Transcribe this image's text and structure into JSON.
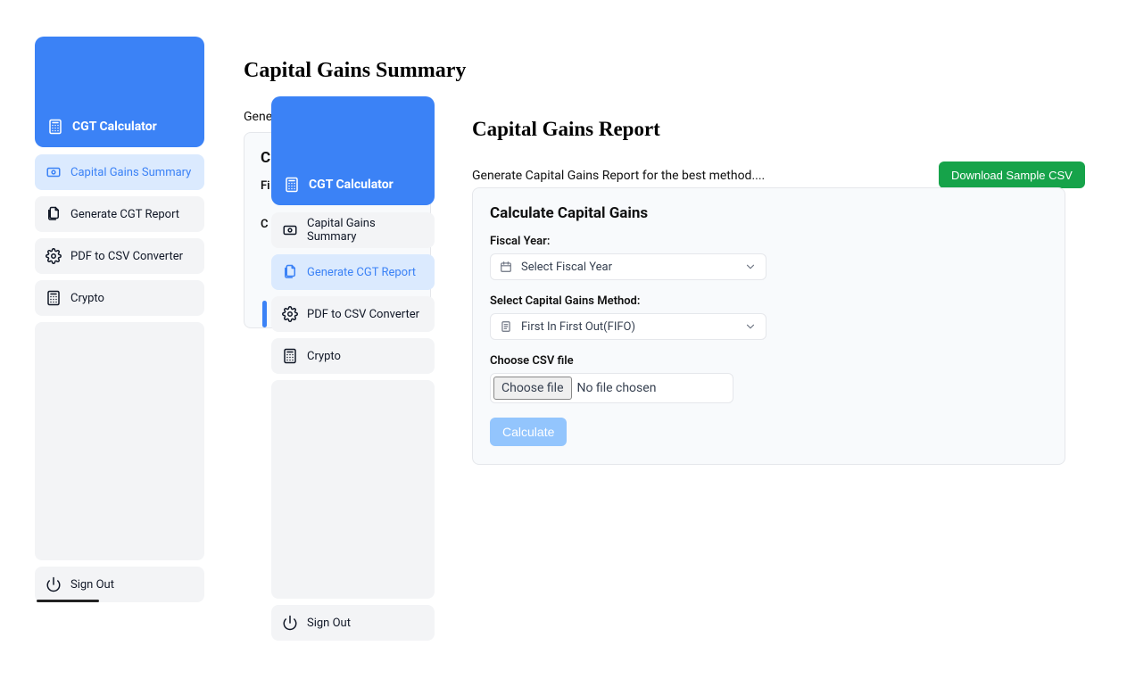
{
  "brand": "CGT Calculator",
  "nav": {
    "summary": "Capital Gains Summary",
    "report": "Generate CGT Report",
    "pdf": "PDF to CSV Converter",
    "crypto": "Crypto",
    "signout": "Sign Out"
  },
  "page1": {
    "title": "Capital Gains Summary",
    "subtitle": "Gene",
    "card_heading_fragment": "C",
    "label_fy_fragment": "Fi",
    "label_method_fragment": "C"
  },
  "page2": {
    "title": "Capital Gains Report",
    "subtitle": "Generate Capital Gains Report for the best method....",
    "download_btn": "Download Sample CSV",
    "card_heading": "Calculate Capital Gains",
    "fy_label": "Fiscal Year:",
    "fy_placeholder": "Select Fiscal Year",
    "method_label": "Select Capital Gains Method:",
    "method_value": "First In First Out(FIFO)",
    "file_label": "Choose CSV file",
    "file_btn": "Choose file",
    "file_status": "No file chosen",
    "calc_btn": "Calculate"
  }
}
